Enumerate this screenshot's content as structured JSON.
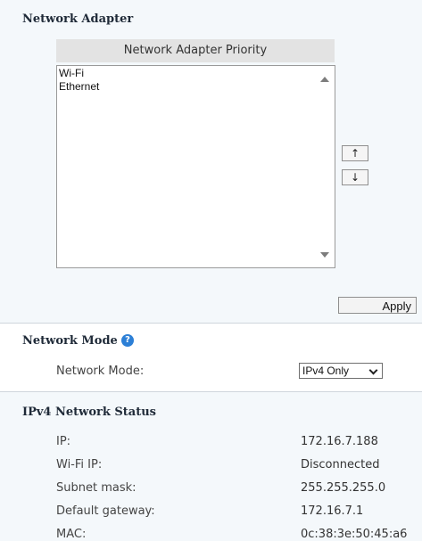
{
  "network_adapter": {
    "heading": "Network Adapter",
    "priority_header": "Network Adapter Priority",
    "items": [
      "Wi-Fi",
      "Ethernet"
    ],
    "move_up_label": "↑",
    "move_down_label": "↓",
    "apply_label": "Apply"
  },
  "network_mode": {
    "heading": "Network Mode",
    "help_label": "?",
    "field_label": "Network Mode:",
    "selected_value": "IPv4 Only"
  },
  "ipv4_status": {
    "heading": "IPv4 Network Status",
    "rows": [
      {
        "label": "IP:",
        "value": "172.16.7.188"
      },
      {
        "label": "Wi-Fi IP:",
        "value": "Disconnected"
      },
      {
        "label": "Subnet mask:",
        "value": "255.255.255.0"
      },
      {
        "label": "Default gateway:",
        "value": "172.16.7.1"
      },
      {
        "label": "MAC:",
        "value": "0c:38:3e:50:45:a6"
      }
    ]
  },
  "colors": {
    "section_bg": "#f4f8fb",
    "help_icon": "#2c7fd6"
  }
}
